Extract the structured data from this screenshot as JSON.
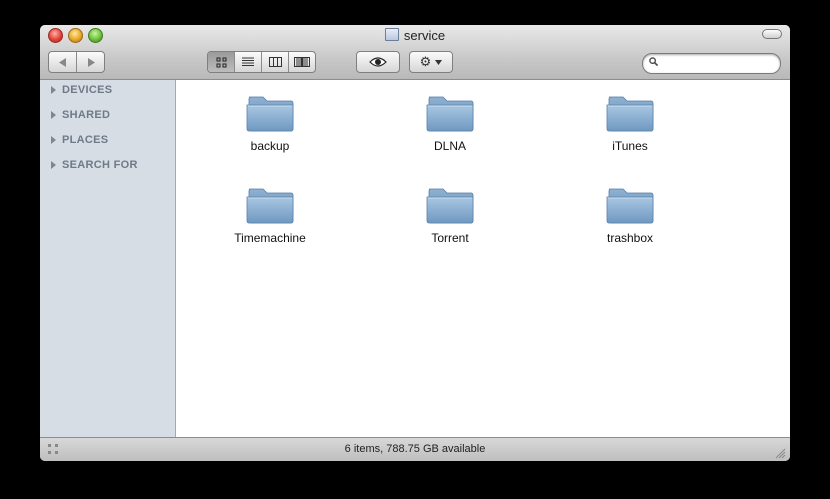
{
  "window": {
    "title": "service"
  },
  "toolbar": {
    "back_icon": "chevron-left-icon",
    "forward_icon": "chevron-right-icon",
    "view_modes": [
      "icon-view-icon",
      "list-view-icon",
      "column-view-icon",
      "coverflow-view-icon"
    ],
    "active_view": "icon-view-icon",
    "quicklook_icon": "eye-icon",
    "action_icon": "gear-icon",
    "search": {
      "placeholder": "",
      "value": ""
    }
  },
  "sidebar": {
    "sections": [
      {
        "label": "DEVICES"
      },
      {
        "label": "SHARED"
      },
      {
        "label": "PLACES"
      },
      {
        "label": "SEARCH FOR"
      }
    ]
  },
  "content": {
    "items": [
      {
        "name": "backup"
      },
      {
        "name": "DLNA"
      },
      {
        "name": "iTunes"
      },
      {
        "name": "Timemachine"
      },
      {
        "name": "Torrent"
      },
      {
        "name": "trashbox"
      }
    ]
  },
  "statusbar": {
    "text": "6 items, 788.75 GB available"
  },
  "colors": {
    "sidebar_bg": "#d6dde5",
    "folder_blue": "#8fb2d3",
    "window_frame": "#000000"
  }
}
